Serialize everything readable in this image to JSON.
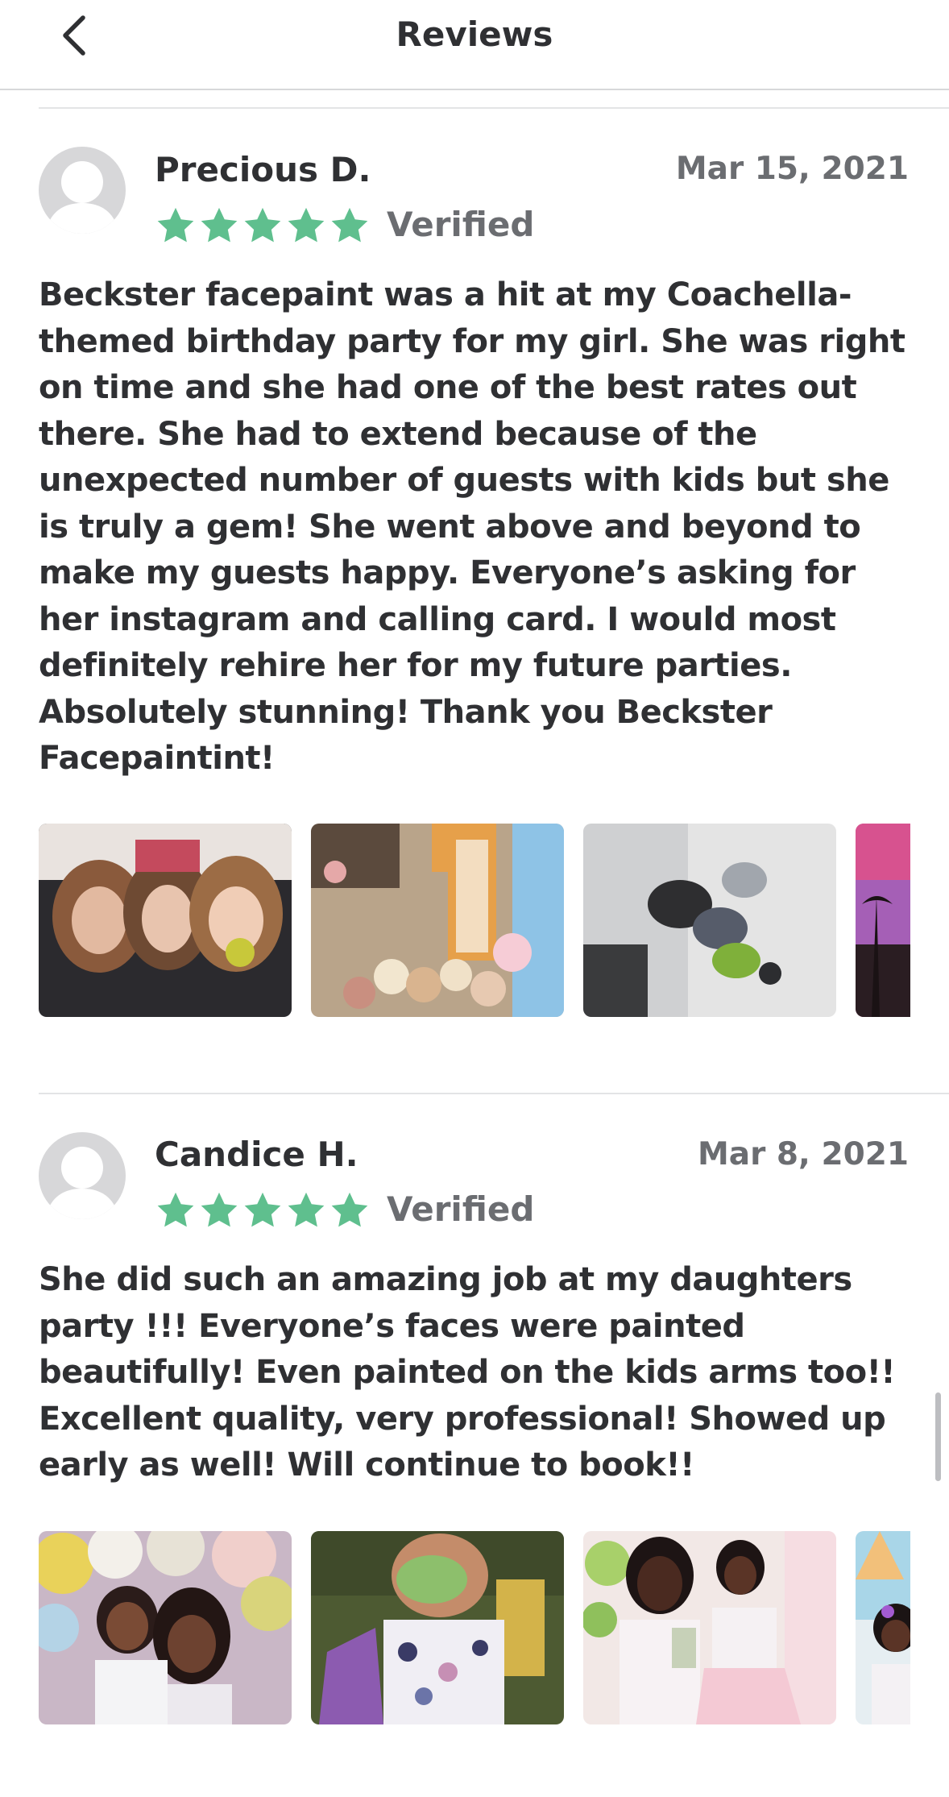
{
  "header": {
    "title": "Reviews",
    "back_icon": "chevron-left-icon"
  },
  "reviews": [
    {
      "name": "Precious D.",
      "date": "Mar 15, 2021",
      "rating": 5,
      "verified_label": "Verified",
      "text": "Beckster facepaint was a hit at my Coachella-themed birthday party for my girl. She was right on time and she had one of the best rates out there. She had to extend because of the unexpected number of guests with kids but she is truly a gem! She went above and beyond to make my guests happy. Everyone’s asking for her instagram and calling card. I would most definitely rehire her for my future parties. Absolutely stunning! Thank you Beckster Facepaintint!",
      "photo_count_visible": 4
    },
    {
      "name": "Candice H.",
      "date": "Mar 8, 2021",
      "rating": 5,
      "verified_label": "Verified",
      "text": "She did such an amazing job at my daughters party !!! Everyone’s faces were painted beautifully! Even painted on the kids arms too!! Excellent quality, very professional! Showed up early as well! Will continue to book!!",
      "photo_count_visible": 4
    }
  ],
  "colors": {
    "star": "#5fbf8e",
    "text": "#2f3033",
    "muted": "#6b6d71",
    "divider": "#e3e4e6",
    "avatar": "#d7d7d9"
  }
}
